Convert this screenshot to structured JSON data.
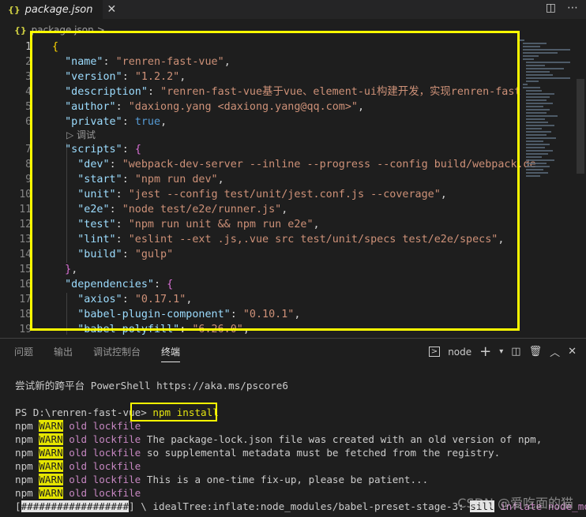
{
  "tab": {
    "icon": "{}",
    "title": "package.json"
  },
  "breadcrumb": {
    "icon": "{}",
    "file": "package.json",
    "sep": "> …"
  },
  "editor": {
    "codelens": "▷ 调试",
    "lines": [
      {
        "n": "1"
      },
      {
        "n": "2"
      },
      {
        "n": "3"
      },
      {
        "n": "4"
      },
      {
        "n": "5"
      },
      {
        "n": "6"
      },
      {
        "n": "7"
      },
      {
        "n": "8"
      },
      {
        "n": "9"
      },
      {
        "n": "10"
      },
      {
        "n": "11"
      },
      {
        "n": "12"
      },
      {
        "n": "13"
      },
      {
        "n": "14"
      },
      {
        "n": "15"
      },
      {
        "n": "16"
      },
      {
        "n": "17"
      },
      {
        "n": "18"
      },
      {
        "n": "19"
      }
    ],
    "name_key": "\"name\"",
    "name_val": "\"renren-fast-vue\"",
    "version_key": "\"version\"",
    "version_val": "\"1.2.2\"",
    "description_key": "\"description\"",
    "description_val": "\"renren-fast-vue基于vue、element-ui构建开发，实现renren-fast",
    "author_key": "\"author\"",
    "author_val": "\"daxiong.yang <daxiong.yang@qq.com>\"",
    "private_key": "\"private\"",
    "private_val": "true",
    "scripts_key": "\"scripts\"",
    "dev_key": "\"dev\"",
    "dev_val": "\"webpack-dev-server --inline --progress --config build/webpack.de",
    "start_key": "\"start\"",
    "start_val": "\"npm run dev\"",
    "unit_key": "\"unit\"",
    "unit_val": "\"jest --config test/unit/jest.conf.js --coverage\"",
    "e2e_key": "\"e2e\"",
    "e2e_val": "\"node test/e2e/runner.js\"",
    "test_key": "\"test\"",
    "test_val": "\"npm run unit && npm run e2e\"",
    "lint_key": "\"lint\"",
    "lint_val": "\"eslint --ext .js,.vue src test/unit/specs test/e2e/specs\"",
    "build_key": "\"build\"",
    "build_val": "\"gulp\"",
    "deps_key": "\"dependencies\"",
    "axios_key": "\"axios\"",
    "axios_val": "\"0.17.1\"",
    "bpc_key": "\"babel-plugin-component\"",
    "bpc_val": "\"0.10.1\"",
    "bp_key": "\"babel-polyfill\"",
    "bp_val": "\"6.26.0\""
  },
  "panel": {
    "tabs": [
      "问题",
      "输出",
      "调试控制台",
      "终端"
    ],
    "shell": "node"
  },
  "terminal": {
    "line1": "尝试新的跨平台 PowerShell https://aka.ms/pscore6",
    "prompt": "PS D:\\renren-fast-vue>",
    "command": " npm install",
    "warn_prefix": "npm",
    "warn_tag": "WARN",
    "warn_old": "old lockfile",
    "warn_msgs": [
      "",
      " The package-lock.json file was created with an old version of npm,",
      " so supplemental metadata must be fetched from the registry.",
      "",
      " This is a one-time fix-up, please be patient...",
      ""
    ],
    "progress_bar": "##################",
    "progress_text": "] \\ idealTree:inflate:node_modules/babel-preset-stage-3: ",
    "progress_tag": "sill",
    "progress_tail": " inflate node_modul"
  },
  "watermark": "CSDN @爱吃面的猫"
}
